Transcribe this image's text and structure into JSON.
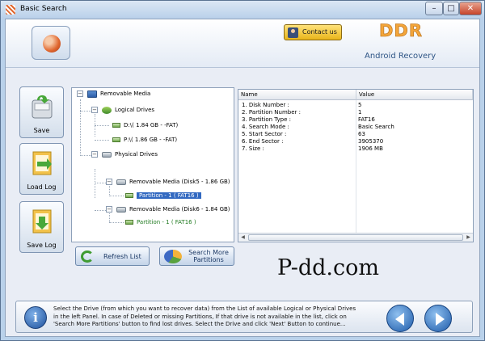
{
  "window": {
    "title": "Basic Search"
  },
  "window_controls": {
    "minimize": "–",
    "maximize": "□",
    "close": "✕"
  },
  "header": {
    "contact_label": "Contact us",
    "brand": "DDR",
    "subtitle": "Android Recovery"
  },
  "sidebar": {
    "save": "Save",
    "load_log": "Load Log",
    "save_log": "Save Log"
  },
  "tree": {
    "root": "Removable Media",
    "logical": "Logical Drives",
    "logical_items": [
      "D:\\( 1.84 GB - -FAT)",
      "P:\\( 1.86 GB - -FAT)"
    ],
    "physical": "Physical Drives",
    "disk5": "Removable Media (Disk5 - 1.86 GB)",
    "disk5_partition": "Partition - 1 ( FAT16 )",
    "disk6": "Removable Media (Disk6 - 1.84 GB)",
    "disk6_partition": "Partition - 1 ( FAT16 )"
  },
  "properties": {
    "columns": [
      "Name",
      "Value"
    ],
    "rows": [
      [
        "1. Disk Number :",
        "5"
      ],
      [
        "2. Partition Number :",
        "1"
      ],
      [
        "3. Partition Type :",
        "FAT16"
      ],
      [
        "4. Search Mode :",
        "Basic Search"
      ],
      [
        "5. Start Sector :",
        "63"
      ],
      [
        "6. End Sector :",
        "3905370"
      ],
      [
        "7. Size :",
        "1906 MB"
      ]
    ]
  },
  "actions": {
    "refresh": "Refresh List",
    "search_more_1": "Search More",
    "search_more_2": "Partitions"
  },
  "watermark": "P-dd.com",
  "help": {
    "info": "i",
    "text": "Select the Drive (from which you want to recover data) from the List of available Logical or Physical Drives in the left Panel. In case of Deleted or missing Partitions, If that drive is not available in the list, click on 'Search More Partitions' button to find lost drives. Select the Drive and click 'Next' Button to continue..."
  },
  "colors": {
    "selection": "#3269c1",
    "brand": "#f3a53a",
    "accent": "#2e5585"
  }
}
